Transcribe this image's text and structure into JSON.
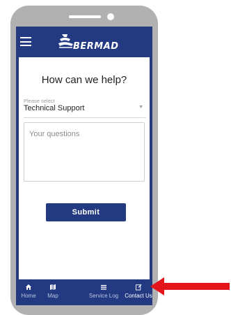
{
  "app": {
    "brand": "BERMAD"
  },
  "page": {
    "title": "How can we help?"
  },
  "form": {
    "select": {
      "placeholder": "Please select",
      "value": "Technical Support"
    },
    "textarea": {
      "placeholder": "Your questions"
    },
    "submit_label": "Submit"
  },
  "bottom_nav": {
    "items": [
      {
        "label": "Home",
        "icon": "home-icon"
      },
      {
        "label": "Map",
        "icon": "map-icon"
      },
      {
        "label": "Service Log",
        "icon": "service-log-icon"
      },
      {
        "label": "Contact Us",
        "icon": "contact-us-icon",
        "active": true
      }
    ]
  },
  "colors": {
    "brand_blue": "#233a82",
    "phone_frame": "#b1b1b1",
    "annotation_arrow": "#e3151b"
  }
}
